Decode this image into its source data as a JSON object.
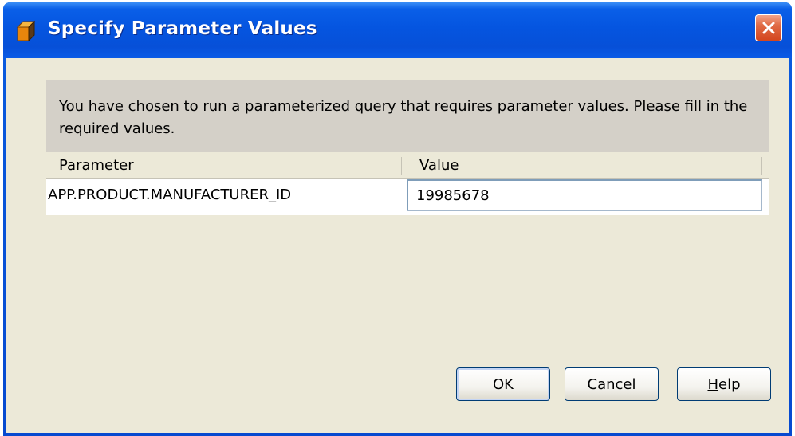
{
  "window": {
    "title": "Specify Parameter Values",
    "title_icon": "cube-icon",
    "close_icon": "close-icon"
  },
  "message": "You have chosen to run a parameterized query that requires parameter values. Please fill in the required values.",
  "table": {
    "columns": [
      "Parameter",
      "Value"
    ],
    "rows": [
      {
        "parameter": "APP.PRODUCT.MANUFACTURER_ID",
        "value": "19985678"
      }
    ]
  },
  "buttons": {
    "ok": "OK",
    "cancel": "Cancel",
    "help_mnemonic": "H",
    "help_rest": "elp"
  },
  "colors": {
    "titlebar": "#0555e0",
    "client_bg": "#ece9d8",
    "message_bg": "#d4d0c8",
    "close_button": "#d4461e"
  }
}
